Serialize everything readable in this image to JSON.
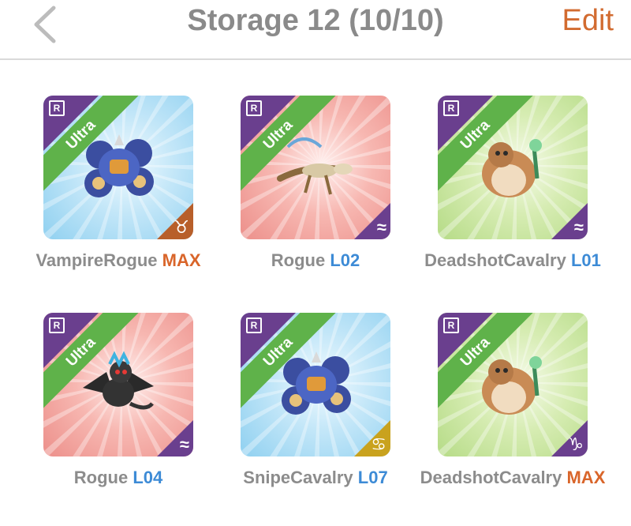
{
  "nav": {
    "title": "Storage 12 (10/10)",
    "edit_label": "Edit",
    "back_icon": "chevron-left-icon"
  },
  "colors": {
    "accent": "#d26b30",
    "title_gray": "#8a8a8a",
    "level_blue": "#3d8bd6",
    "level_max": "#d9652a",
    "rarity_band": "#5fb24a",
    "corner_purple": "#6a3f8e"
  },
  "cards": [
    {
      "name": "VampireRogue",
      "level": "MAX",
      "rarity": "Ultra",
      "badge": "R",
      "bg": "blue",
      "sign_icon": "taurus-icon",
      "sign_glyph": "♉",
      "sign_color": "#b85f2a",
      "monster": "robot-rover"
    },
    {
      "name": "Rogue",
      "level": "L02",
      "rarity": "Ultra",
      "badge": "R",
      "bg": "red",
      "sign_icon": "aquarius-icon",
      "sign_glyph": "≈",
      "sign_color": "#6a3f8e",
      "monster": "skeleton-lizard"
    },
    {
      "name": "DeadshotCavalry",
      "level": "L01",
      "rarity": "Ultra",
      "badge": "R",
      "bg": "green",
      "sign_icon": "aquarius-icon",
      "sign_glyph": "≈",
      "sign_color": "#6a3f8e",
      "monster": "fat-hamster"
    },
    {
      "name": "Rogue",
      "level": "L04",
      "rarity": "Ultra",
      "badge": "R",
      "bg": "red",
      "sign_icon": "aquarius-icon",
      "sign_glyph": "≈",
      "sign_color": "#6a3f8e",
      "monster": "dark-dragon"
    },
    {
      "name": "SnipeCavalry",
      "level": "L07",
      "rarity": "Ultra",
      "badge": "R",
      "bg": "blue",
      "sign_icon": "cancer-icon",
      "sign_glyph": "♋",
      "sign_color": "#c9a21e",
      "monster": "robot-rover"
    },
    {
      "name": "DeadshotCavalry",
      "level": "MAX",
      "rarity": "Ultra",
      "badge": "R",
      "bg": "green",
      "sign_icon": "capricorn-icon",
      "sign_glyph": "♑",
      "sign_color": "#6a3f8e",
      "monster": "fat-hamster"
    }
  ]
}
